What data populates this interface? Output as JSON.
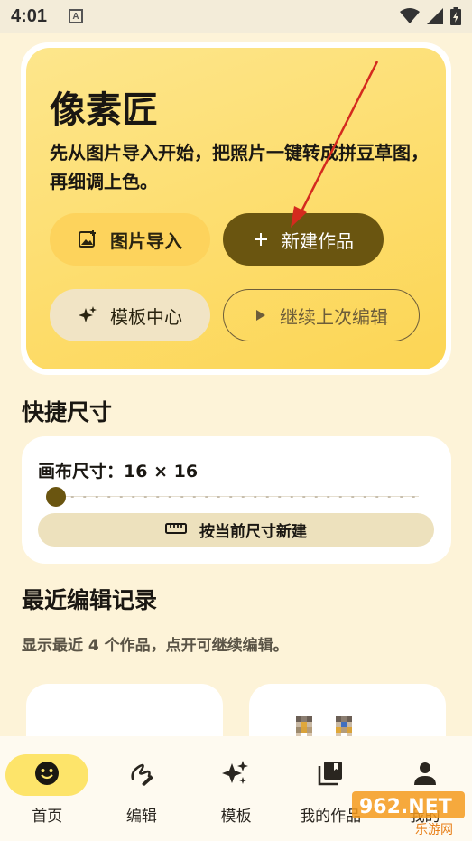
{
  "status_bar": {
    "time": "4:01",
    "notification_letter": "A"
  },
  "hero": {
    "title": "像素匠",
    "description": "先从图片导入开始，把照片一键转成拼豆草图，再细调上色。",
    "import_label": "图片导入",
    "new_label": "新建作品",
    "template_label": "模板中心",
    "continue_label": "继续上次编辑"
  },
  "quick_size": {
    "title": "快捷尺寸",
    "canvas_size_label": "画布尺寸：",
    "canvas_size_value": "16 × 16",
    "slider_value_fraction": 0.0,
    "new_button_label": "按当前尺寸新建"
  },
  "recent": {
    "title": "最近编辑记录",
    "description": "显示最近 4 个作品，点开可继续编辑。"
  },
  "bottom_nav": {
    "items": [
      {
        "label": "首页",
        "icon": "smiley-icon",
        "active": true
      },
      {
        "label": "编辑",
        "icon": "draw-icon",
        "active": false
      },
      {
        "label": "模板",
        "icon": "sparkle-icon",
        "active": false
      },
      {
        "label": "我的作品",
        "icon": "library-icon",
        "active": false
      },
      {
        "label": "我的",
        "icon": "person-icon",
        "active": false
      }
    ]
  },
  "watermark": {
    "brand": "962.NET",
    "subtitle": "乐游网"
  },
  "colors": {
    "background": "#fdf3d8",
    "hero_yellow": "#fde68c",
    "primary_brown": "#6a5510",
    "nav_active": "#fde46a",
    "annotation_red": "#d42a1e"
  }
}
